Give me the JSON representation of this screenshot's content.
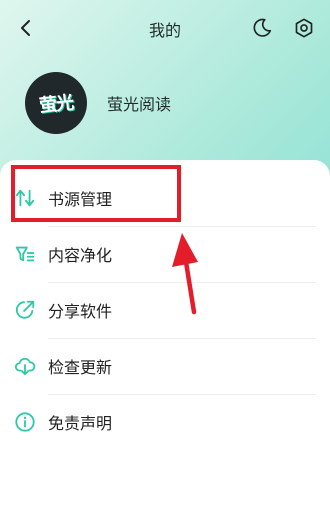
{
  "header": {
    "title": "我的"
  },
  "profile": {
    "avatar_text": "萤光",
    "username": "萤光阅读"
  },
  "menu": [
    {
      "label": "书源管理",
      "icon": "swap-arrows-icon"
    },
    {
      "label": "内容净化",
      "icon": "filter-icon"
    },
    {
      "label": "分享软件",
      "icon": "share-icon"
    },
    {
      "label": "检查更新",
      "icon": "cloud-download-icon"
    },
    {
      "label": "免责声明",
      "icon": "info-icon"
    }
  ],
  "colors": {
    "accent": "#2fc9a7",
    "annotation_red": "#e41d2a"
  }
}
